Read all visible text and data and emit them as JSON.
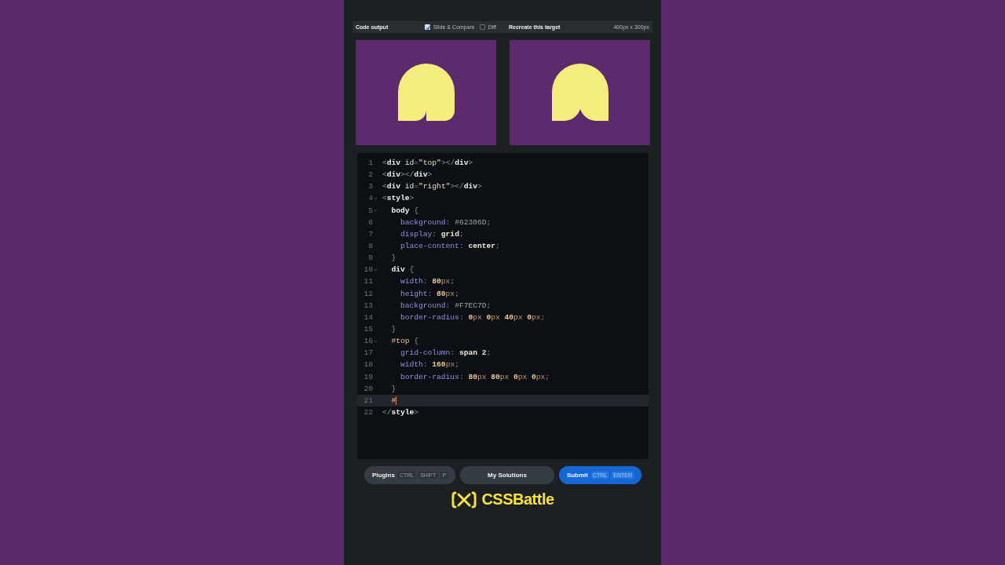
{
  "toolbar": {
    "output_title": "Code output",
    "options": [
      {
        "label": "Slide & Compare",
        "checked": true
      },
      {
        "label": "Diff",
        "checked": false
      }
    ],
    "target_title": "Recreate this target",
    "target_size": "400px x 300px"
  },
  "previews": [
    {
      "kind": "output"
    },
    {
      "kind": "target"
    }
  ],
  "editor": {
    "lines": [
      {
        "number": "1",
        "foldable": false,
        "active": false,
        "tokens": [
          {
            "kind": "punct",
            "text": "<"
          },
          {
            "kind": "tag",
            "text": "div"
          },
          {
            "kind": "attr",
            "text": " id"
          },
          {
            "kind": "punct",
            "text": "="
          },
          {
            "kind": "string",
            "text": "\"top\""
          },
          {
            "kind": "punct",
            "text": "></"
          },
          {
            "kind": "tag",
            "text": "div"
          },
          {
            "kind": "punct",
            "text": ">"
          }
        ]
      },
      {
        "number": "2",
        "foldable": false,
        "active": false,
        "tokens": [
          {
            "kind": "punct",
            "text": "<"
          },
          {
            "kind": "tag",
            "text": "div"
          },
          {
            "kind": "punct",
            "text": "></"
          },
          {
            "kind": "tag",
            "text": "div"
          },
          {
            "kind": "punct",
            "text": ">"
          }
        ]
      },
      {
        "number": "3",
        "foldable": false,
        "active": false,
        "tokens": [
          {
            "kind": "punct",
            "text": "<"
          },
          {
            "kind": "tag",
            "text": "div"
          },
          {
            "kind": "attr",
            "text": " id"
          },
          {
            "kind": "punct",
            "text": "="
          },
          {
            "kind": "string",
            "text": "\"right\""
          },
          {
            "kind": "punct",
            "text": "></"
          },
          {
            "kind": "tag",
            "text": "div"
          },
          {
            "kind": "punct",
            "text": ">"
          }
        ]
      },
      {
        "number": "4",
        "foldable": true,
        "active": false,
        "tokens": [
          {
            "kind": "punct",
            "text": "<"
          },
          {
            "kind": "tag",
            "text": "style"
          },
          {
            "kind": "punct",
            "text": ">"
          }
        ]
      },
      {
        "number": "5",
        "foldable": true,
        "active": false,
        "tokens": [
          {
            "kind": "tag",
            "text": "  body"
          },
          {
            "kind": "punct",
            "text": " {"
          }
        ]
      },
      {
        "number": "6",
        "foldable": false,
        "active": false,
        "tokens": [
          {
            "kind": "prop",
            "text": "    background"
          },
          {
            "kind": "punct",
            "text": ": "
          },
          {
            "kind": "hex",
            "text": "#62306D"
          },
          {
            "kind": "punct",
            "text": ";"
          }
        ]
      },
      {
        "number": "7",
        "foldable": false,
        "active": false,
        "tokens": [
          {
            "kind": "prop",
            "text": "    display"
          },
          {
            "kind": "punct",
            "text": ": "
          },
          {
            "kind": "value",
            "text": "grid"
          },
          {
            "kind": "punct",
            "text": ";"
          }
        ]
      },
      {
        "number": "8",
        "foldable": false,
        "active": false,
        "tokens": [
          {
            "kind": "prop",
            "text": "    place-content"
          },
          {
            "kind": "punct",
            "text": ": "
          },
          {
            "kind": "value",
            "text": "center"
          },
          {
            "kind": "punct",
            "text": ";"
          }
        ]
      },
      {
        "number": "9",
        "foldable": false,
        "active": false,
        "tokens": [
          {
            "kind": "punct",
            "text": "  }"
          }
        ]
      },
      {
        "number": "10",
        "foldable": true,
        "active": false,
        "tokens": [
          {
            "kind": "tag",
            "text": "  div"
          },
          {
            "kind": "punct",
            "text": " {"
          }
        ]
      },
      {
        "number": "11",
        "foldable": false,
        "active": false,
        "tokens": [
          {
            "kind": "prop",
            "text": "    width"
          },
          {
            "kind": "punct",
            "text": ": "
          },
          {
            "kind": "num",
            "text": "80"
          },
          {
            "kind": "unit",
            "text": "px"
          },
          {
            "kind": "punct",
            "text": ";"
          }
        ]
      },
      {
        "number": "12",
        "foldable": false,
        "active": false,
        "tokens": [
          {
            "kind": "prop",
            "text": "    height"
          },
          {
            "kind": "punct",
            "text": ": "
          },
          {
            "kind": "num",
            "text": "80"
          },
          {
            "kind": "unit",
            "text": "px"
          },
          {
            "kind": "punct",
            "text": ";"
          }
        ]
      },
      {
        "number": "13",
        "foldable": false,
        "active": false,
        "tokens": [
          {
            "kind": "prop",
            "text": "    background"
          },
          {
            "kind": "punct",
            "text": ": "
          },
          {
            "kind": "hex",
            "text": "#F7EC7D"
          },
          {
            "kind": "punct",
            "text": ";"
          }
        ]
      },
      {
        "number": "14",
        "foldable": false,
        "active": false,
        "tokens": [
          {
            "kind": "prop",
            "text": "    border-radius"
          },
          {
            "kind": "punct",
            "text": ": "
          },
          {
            "kind": "num",
            "text": "0"
          },
          {
            "kind": "unit",
            "text": "px "
          },
          {
            "kind": "num",
            "text": "0"
          },
          {
            "kind": "unit",
            "text": "px "
          },
          {
            "kind": "num",
            "text": "40"
          },
          {
            "kind": "unit",
            "text": "px "
          },
          {
            "kind": "num",
            "text": "0"
          },
          {
            "kind": "unit",
            "text": "px"
          },
          {
            "kind": "punct",
            "text": ";"
          }
        ]
      },
      {
        "number": "15",
        "foldable": false,
        "active": false,
        "tokens": [
          {
            "kind": "punct",
            "text": "  }"
          }
        ]
      },
      {
        "number": "16",
        "foldable": true,
        "active": false,
        "tokens": [
          {
            "kind": "selector",
            "text": "  #top"
          },
          {
            "kind": "punct",
            "text": " {"
          }
        ]
      },
      {
        "number": "17",
        "foldable": false,
        "active": false,
        "tokens": [
          {
            "kind": "prop",
            "text": "    grid-column"
          },
          {
            "kind": "punct",
            "text": ": "
          },
          {
            "kind": "value",
            "text": "span 2"
          },
          {
            "kind": "punct",
            "text": ";"
          }
        ]
      },
      {
        "number": "18",
        "foldable": false,
        "active": false,
        "tokens": [
          {
            "kind": "prop",
            "text": "    width"
          },
          {
            "kind": "punct",
            "text": ": "
          },
          {
            "kind": "num",
            "text": "160"
          },
          {
            "kind": "unit",
            "text": "px"
          },
          {
            "kind": "punct",
            "text": ";"
          }
        ]
      },
      {
        "number": "19",
        "foldable": false,
        "active": false,
        "tokens": [
          {
            "kind": "prop",
            "text": "    border-radius"
          },
          {
            "kind": "punct",
            "text": ": "
          },
          {
            "kind": "num",
            "text": "80"
          },
          {
            "kind": "unit",
            "text": "px "
          },
          {
            "kind": "num",
            "text": "80"
          },
          {
            "kind": "unit",
            "text": "px "
          },
          {
            "kind": "num",
            "text": "0"
          },
          {
            "kind": "unit",
            "text": "px "
          },
          {
            "kind": "num",
            "text": "0"
          },
          {
            "kind": "unit",
            "text": "px"
          },
          {
            "kind": "punct",
            "text": ";"
          }
        ]
      },
      {
        "number": "20",
        "foldable": false,
        "active": false,
        "tokens": [
          {
            "kind": "punct",
            "text": "  }"
          }
        ]
      },
      {
        "number": "21",
        "foldable": false,
        "active": true,
        "tokens": [
          {
            "kind": "selector",
            "text": "  #"
          }
        ]
      },
      {
        "number": "22",
        "foldable": false,
        "active": false,
        "tokens": [
          {
            "kind": "punct",
            "text": "</"
          },
          {
            "kind": "tag",
            "text": "style"
          },
          {
            "kind": "punct",
            "text": ">"
          }
        ]
      }
    ]
  },
  "actions": [
    {
      "label": "Plugins",
      "kind": "secondary",
      "keys": [
        "CTRL",
        "SHIFT",
        "P"
      ]
    },
    {
      "label": "My Solutions",
      "kind": "secondary"
    },
    {
      "label": "Submit",
      "kind": "primary",
      "keys": [
        "CTRL",
        "ENTER"
      ]
    }
  ],
  "brand": {
    "name": "CSSBattle"
  }
}
